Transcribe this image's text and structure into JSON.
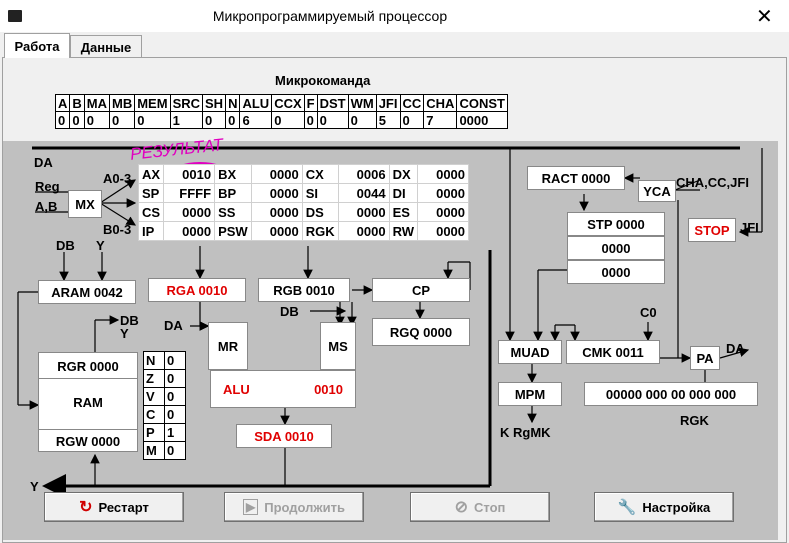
{
  "window": {
    "title": "Микропрограммируемый процессор"
  },
  "tabs": [
    {
      "label": "Работа"
    },
    {
      "label": "Данные"
    }
  ],
  "microcommand": {
    "title": "Микрокоманда",
    "headers": [
      "A",
      "B",
      "MA",
      "MB",
      "MEM",
      "SRC",
      "SH",
      "N",
      "ALU",
      "CCX",
      "F",
      "DST",
      "WM",
      "JFI",
      "CC",
      "CHA",
      "CONST"
    ],
    "values": [
      "0",
      "0",
      "0",
      "0",
      "0",
      "1",
      "0",
      "0",
      "6",
      "0",
      "0",
      "0",
      "0",
      "5",
      "0",
      "7",
      "0000"
    ]
  },
  "bus_labels": {
    "da_top": "DA",
    "reg": "Reg",
    "ab": "A,B",
    "a03": "A0-3",
    "b03": "B0-3",
    "mx": "MX",
    "y_bottom": "Y",
    "db": "DB",
    "y": "Y",
    "da_mr": "DA",
    "db_ms": "DB",
    "db_ram": "DB",
    "y_ram": "Y"
  },
  "registers": [
    [
      {
        "n": "AX",
        "v": "0010"
      },
      {
        "n": "BX",
        "v": "0000"
      },
      {
        "n": "CX",
        "v": "0006"
      },
      {
        "n": "DX",
        "v": "0000"
      }
    ],
    [
      {
        "n": "SP",
        "v": "FFFF"
      },
      {
        "n": "BP",
        "v": "0000"
      },
      {
        "n": "SI",
        "v": "0044"
      },
      {
        "n": "DI",
        "v": "0000"
      }
    ],
    [
      {
        "n": "CS",
        "v": "0000"
      },
      {
        "n": "SS",
        "v": "0000"
      },
      {
        "n": "DS",
        "v": "0000"
      },
      {
        "n": "ES",
        "v": "0000"
      }
    ],
    [
      {
        "n": "IP",
        "v": "0000"
      },
      {
        "n": "PSW",
        "v": "0000"
      },
      {
        "n": "RGK",
        "v": "0000"
      },
      {
        "n": "RW",
        "v": "0000"
      }
    ]
  ],
  "annotation": "РЕЗУЛЬТАТ",
  "blocks": {
    "aram": "ARAM  0042",
    "rga": "RGA  0010",
    "rgb": "RGB  0010",
    "cp": "CP",
    "rgq": "RGQ  0000",
    "mr": "MR",
    "ms": "MS",
    "alu_label": "ALU",
    "alu_value": "0010",
    "sda": "SDA   0010",
    "rgr": "RGR   0000",
    "ram": "RAM",
    "rgw": "RGW  0000",
    "ract": "RACT   0000",
    "yca": "YCA",
    "stp": "STP   0000",
    "stack1": "0000",
    "stack2": "0000",
    "stop": "STOP",
    "muad": "MUAD",
    "cmk": "CMK    0011",
    "pa": "PA",
    "mpm": "MPM",
    "rgk_value": "00000 000 00 000 000",
    "rgk_label": "RGK",
    "krgmk": "K RgMK",
    "c0": "C0",
    "cha_cc_jfi": "CHA,CC,JFI",
    "jfi": "JFI",
    "da_pa": "DA"
  },
  "flags": [
    {
      "n": "N",
      "v": "0"
    },
    {
      "n": "Z",
      "v": "0"
    },
    {
      "n": "V",
      "v": "0"
    },
    {
      "n": "C",
      "v": "0"
    },
    {
      "n": "P",
      "v": "1"
    },
    {
      "n": "M",
      "v": "0"
    }
  ],
  "buttons": {
    "restart": "Рестарт",
    "continue": "Продолжить",
    "stop": "Стоп",
    "settings": "Настройка"
  }
}
